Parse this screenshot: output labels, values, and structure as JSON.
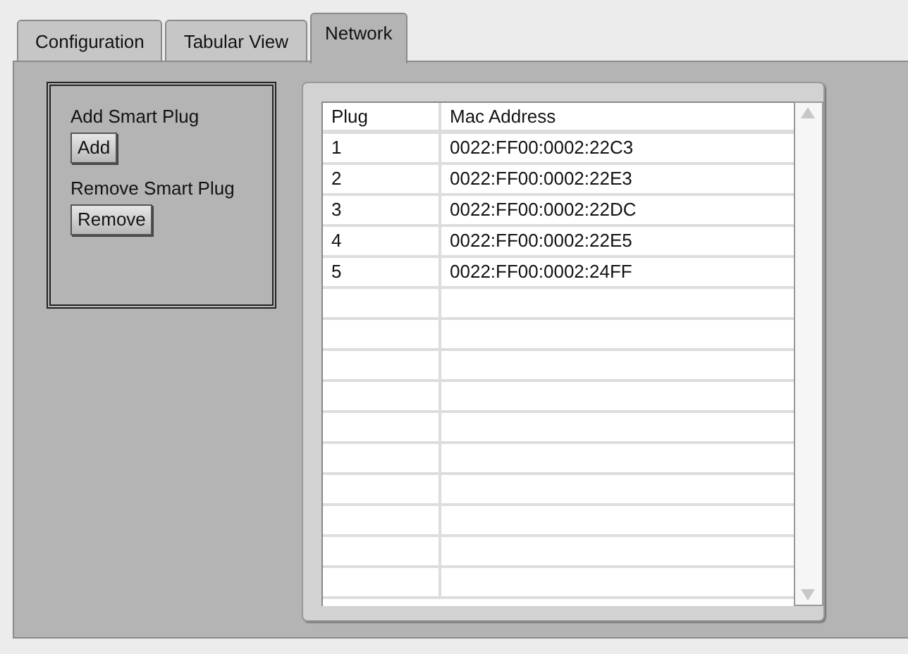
{
  "tabs": [
    {
      "label": "Configuration",
      "selected": false
    },
    {
      "label": "Tabular View",
      "selected": false
    },
    {
      "label": "Network",
      "selected": true
    }
  ],
  "controls": [
    {
      "label": "Add Smart Plug",
      "button": "Add"
    },
    {
      "label": "Remove Smart Plug",
      "button": "Remove"
    }
  ],
  "table": {
    "columns": [
      "Plug",
      "Mac Address"
    ],
    "rows": [
      [
        "1",
        "0022:FF00:0002:22C3"
      ],
      [
        "2",
        "0022:FF00:0002:22E3"
      ],
      [
        "3",
        "0022:FF00:0002:22DC"
      ],
      [
        "4",
        "0022:FF00:0002:22E5"
      ],
      [
        "5",
        "0022:FF00:0002:24FF"
      ]
    ]
  }
}
